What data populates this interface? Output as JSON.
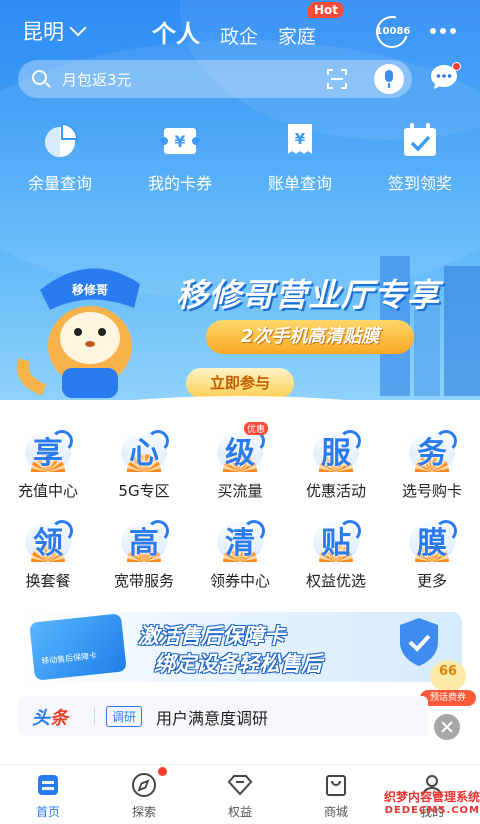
{
  "header": {
    "city": "昆明",
    "tabs": [
      {
        "label": "个人",
        "active": true
      },
      {
        "label": "政企",
        "active": false
      },
      {
        "label": "家庭",
        "active": false
      }
    ],
    "hot_badge": "Hot",
    "hotline": "10086"
  },
  "search": {
    "placeholder": "月包返3元"
  },
  "quick": [
    {
      "label": "余量查询",
      "icon": "pie-chart-icon"
    },
    {
      "label": "我的卡券",
      "icon": "coupon-icon"
    },
    {
      "label": "账单查询",
      "icon": "bill-icon"
    },
    {
      "label": "签到领奖",
      "icon": "calendar-check-icon"
    }
  ],
  "banner": {
    "title": "移修哥营业厅专享",
    "subtitle": "2次手机高清贴膜",
    "button": "立即参与",
    "mascot_cap": "移修哥"
  },
  "services": [
    {
      "char": "享",
      "label": "充值中心"
    },
    {
      "char": "心",
      "label": "5G专区"
    },
    {
      "char": "级",
      "label": "买流量",
      "tag": "优惠"
    },
    {
      "char": "服",
      "label": "优惠活动"
    },
    {
      "char": "务",
      "label": "选号购卡"
    },
    {
      "char": "领",
      "label": "换套餐"
    },
    {
      "char": "高",
      "label": "宽带服务"
    },
    {
      "char": "清",
      "label": "领券中心"
    },
    {
      "char": "贴",
      "label": "权益优选"
    },
    {
      "char": "膜",
      "label": "更多"
    }
  ],
  "promo": {
    "line1": "激活售后保障卡",
    "line2": "绑定设备轻松售后",
    "card_text": "移动售后保障卡"
  },
  "float_ad": {
    "number": "66",
    "pill": "预话费券"
  },
  "headline": {
    "logo_a": "头",
    "logo_b": "条",
    "tag": "调研",
    "text": "用户满意度调研"
  },
  "bottom_nav": [
    {
      "label": "首页",
      "active": true,
      "icon": "home-icon"
    },
    {
      "label": "探索",
      "active": false,
      "icon": "compass-icon"
    },
    {
      "label": "权益",
      "active": false,
      "icon": "diamond-icon"
    },
    {
      "label": "商城",
      "active": false,
      "icon": "shopping-bag-icon"
    },
    {
      "label": "我的",
      "active": false,
      "icon": "user-icon"
    }
  ],
  "watermark": {
    "line1": "织梦内容管理系统",
    "line2": "DEDECMS.COM"
  },
  "colors": {
    "primary": "#2a7bf0",
    "accent_orange": "#f6a823",
    "badge_red": "#ff4b3a"
  }
}
